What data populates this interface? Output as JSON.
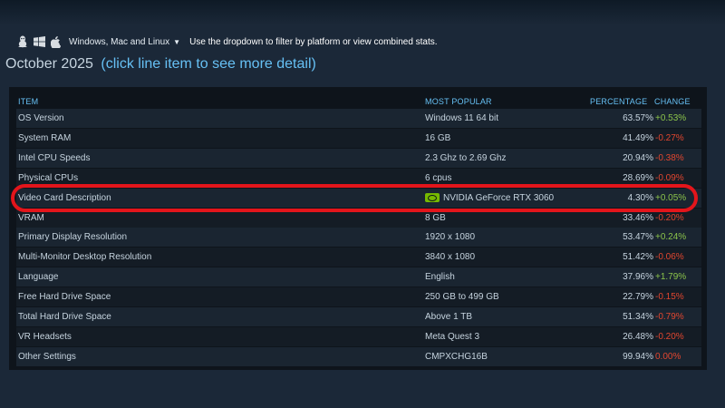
{
  "top": {
    "faded_text": ""
  },
  "platform_bar": {
    "icons": [
      "linux-icon",
      "windows-icon",
      "apple-icon"
    ],
    "selected": "Windows, Mac and Linux",
    "hint": "Use the dropdown to filter by platform or view combined stats."
  },
  "title": {
    "month": "October 2025",
    "hint": "(click line item to see more detail)"
  },
  "table": {
    "headers": {
      "item": "ITEM",
      "popular": "MOST POPULAR",
      "percentage": "PERCENTAGE",
      "change": "CHANGE"
    },
    "rows": [
      {
        "item": "OS Version",
        "popular": "Windows 11 64 bit",
        "percentage": "63.57%",
        "change": "+0.53%",
        "direction": "up"
      },
      {
        "item": "System RAM",
        "popular": "16 GB",
        "percentage": "41.49%",
        "change": "-0.27%",
        "direction": "down"
      },
      {
        "item": "Intel CPU Speeds",
        "popular": "2.3 Ghz to 2.69 Ghz",
        "percentage": "20.94%",
        "change": "-0.38%",
        "direction": "down"
      },
      {
        "item": "Physical CPUs",
        "popular": "6 cpus",
        "percentage": "28.69%",
        "change": "-0.09%",
        "direction": "down"
      },
      {
        "item": "Video Card Description",
        "popular": "NVIDIA GeForce RTX 3060",
        "percentage": "4.30%",
        "change": "+0.05%",
        "direction": "up",
        "icon": "nvidia-logo-icon",
        "highlighted": true
      },
      {
        "item": "VRAM",
        "popular": "8 GB",
        "percentage": "33.46%",
        "change": "-0.20%",
        "direction": "down"
      },
      {
        "item": "Primary Display Resolution",
        "popular": "1920 x 1080",
        "percentage": "53.47%",
        "change": "+0.24%",
        "direction": "up"
      },
      {
        "item": "Multi-Monitor Desktop Resolution",
        "popular": "3840 x 1080",
        "percentage": "51.42%",
        "change": "-0.06%",
        "direction": "down"
      },
      {
        "item": "Language",
        "popular": "English",
        "percentage": "37.96%",
        "change": "+1.79%",
        "direction": "up"
      },
      {
        "item": "Free Hard Drive Space",
        "popular": "250 GB to 499 GB",
        "percentage": "22.79%",
        "change": "-0.15%",
        "direction": "down"
      },
      {
        "item": "Total Hard Drive Space",
        "popular": "Above 1 TB",
        "percentage": "51.34%",
        "change": "-0.79%",
        "direction": "down"
      },
      {
        "item": "VR Headsets",
        "popular": "Meta Quest 3",
        "percentage": "26.48%",
        "change": "-0.20%",
        "direction": "down"
      },
      {
        "item": "Other Settings",
        "popular": "CMPXCHG16B",
        "percentage": "99.94%",
        "change": "0.00%",
        "direction": "flat"
      }
    ]
  },
  "colors": {
    "background": "#1b2838",
    "panel": "#0e141b",
    "accent": "#66c0f4",
    "positive": "#8bc34a",
    "negative": "#e2462f",
    "highlight_ring": "#e3151b"
  }
}
